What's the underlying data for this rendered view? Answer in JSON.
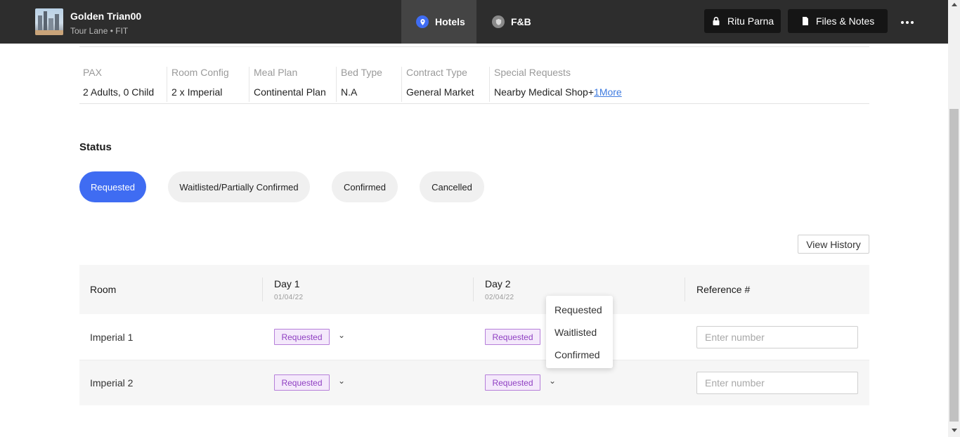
{
  "header": {
    "trip_title": "Golden Trian00",
    "trip_subtitle": "Tour Lane • FIT",
    "tabs": [
      {
        "label": "Hotels",
        "icon": "location-pin-icon",
        "active": true
      },
      {
        "label": "F&B",
        "icon": "shield-icon",
        "active": false
      }
    ],
    "user_label": "Ritu Parna",
    "files_label": "Files & Notes",
    "accent_color": "#3f6cf2"
  },
  "details": {
    "columns": [
      {
        "label": "PAX",
        "value": "2 Adults, 0 Child"
      },
      {
        "label": "Room Config",
        "value": "2 x Imperial"
      },
      {
        "label": "Meal Plan",
        "value": "Continental Plan"
      },
      {
        "label": "Bed Type",
        "value": "N.A"
      },
      {
        "label": "Contract Type",
        "value": "General Market"
      },
      {
        "label": "Special Requests",
        "value": "Nearby Medical Shop+",
        "more": "1More"
      }
    ]
  },
  "status": {
    "title": "Status",
    "options": [
      {
        "label": "Requested",
        "selected": true
      },
      {
        "label": "Waitlisted/Partially Confirmed",
        "selected": false
      },
      {
        "label": "Confirmed",
        "selected": false
      },
      {
        "label": "Cancelled",
        "selected": false
      }
    ]
  },
  "history_label": "View History",
  "table": {
    "headers": {
      "room": "Room",
      "day1": {
        "title": "Day 1",
        "date": "01/04/22"
      },
      "day2": {
        "title": "Day 2",
        "date": "02/04/22"
      },
      "reference": "Reference #"
    },
    "rows": [
      {
        "room": "Imperial 1",
        "day1": "Requested",
        "day2": "Requested",
        "reference_placeholder": "Enter number"
      },
      {
        "room": "Imperial 2",
        "day1": "Requested",
        "day2": "Requested",
        "reference_placeholder": "Enter number"
      }
    ]
  },
  "dropdown": {
    "options": [
      "Requested",
      "Waitlisted",
      "Confirmed"
    ]
  }
}
